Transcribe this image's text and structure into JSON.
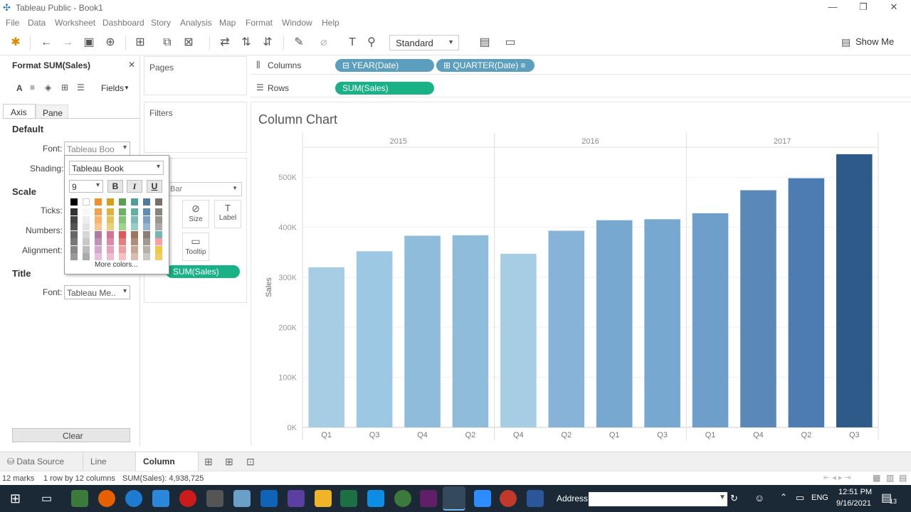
{
  "window": {
    "title": "Tableau Public - Book1",
    "min": "—",
    "restore": "❐",
    "close": "✕"
  },
  "menu": [
    "File",
    "Data",
    "Worksheet",
    "Dashboard",
    "Story",
    "Analysis",
    "Map",
    "Format",
    "Window",
    "Help"
  ],
  "toolbar": {
    "view_size": "Standard",
    "show_me": "Show Me"
  },
  "format_panel": {
    "title": "Format SUM(Sales)",
    "fields_label": "Fields",
    "tabs": [
      "Axis",
      "Pane"
    ],
    "default_head": "Default",
    "font_label": "Font:",
    "font_value": "Tableau Boo",
    "shading_label": "Shading:",
    "scale_head": "Scale",
    "ticks_label": "Ticks:",
    "numbers_label": "Numbers:",
    "alignment_label": "Alignment:",
    "title_head": "Title",
    "title_font_label": "Font:",
    "title_font_value": "Tableau Me..",
    "clear_label": "Clear"
  },
  "font_popup": {
    "font_name": "Tableau Book",
    "font_size": "9",
    "bold": "B",
    "italic": "I",
    "underline": "U",
    "more_colors": "More colors...",
    "top_colors": [
      "#000000",
      "#ffffff",
      "#f28e2b",
      "#d4a017",
      "#59a14f",
      "#4e9e99",
      "#4e79a7",
      "#79706e"
    ],
    "colors": [
      [
        "#333333",
        "#f7f7f7",
        "#f4a04b",
        "#dcb43a",
        "#6cb35f",
        "#63ada7",
        "#5f8bb8",
        "#8a827f"
      ],
      [
        "#444444",
        "#eeeeee",
        "#f7b36b",
        "#e2c25c",
        "#84c277",
        "#7dbcb6",
        "#7b9fc8",
        "#9c9491"
      ],
      [
        "#555555",
        "#e3e3e3",
        "#f9c58c",
        "#e9d07e",
        "#9fd18f",
        "#98ccc6",
        "#97b4d6",
        "#afa7a4"
      ],
      [
        "#666666",
        "#d6d6d6",
        "#b07aa1",
        "#d37295",
        "#e15759",
        "#9d7660",
        "#8a7f78",
        "#76b7b2"
      ],
      [
        "#777777",
        "#c8c8c8",
        "#c390b7",
        "#dd8aa8",
        "#ea7b7c",
        "#b18d79",
        "#a09891",
        "#ff9da7"
      ],
      [
        "#888888",
        "#bbbbbb",
        "#d6a7cd",
        "#e6a2bb",
        "#f29e9f",
        "#c5a593",
        "#b6b0aa",
        "#edc948"
      ],
      [
        "#999999",
        "#aaaaaa",
        "#e6bfdf",
        "#eebbcf",
        "#f8c0c0",
        "#d8bdae",
        "#cbc7c3",
        "#f1ce63"
      ]
    ]
  },
  "cards": {
    "pages": "Pages",
    "filters": "Filters",
    "marks_type": "Bar",
    "size": "Size",
    "label": "Label",
    "tooltip": "Tooltip",
    "marks_pill": "SUM(Sales)"
  },
  "shelves": {
    "columns_label": "Columns",
    "rows_label": "Rows",
    "col_pill1": "YEAR(Date)",
    "col_pill2": "QUARTER(Date)",
    "row_pill": "SUM(Sales)"
  },
  "sheet_title": "Column Chart",
  "chart_data": {
    "type": "bar",
    "ylabel": "Sales",
    "ylim": [
      0,
      560000
    ],
    "yticks": [
      0,
      100000,
      200000,
      300000,
      400000,
      500000
    ],
    "ytick_labels": [
      "0K",
      "100K",
      "200K",
      "300K",
      "400K",
      "500K"
    ],
    "years": [
      "2015",
      "2016",
      "2017"
    ],
    "categories": [
      "Q1",
      "Q3",
      "Q4",
      "Q2",
      "Q4",
      "Q2",
      "Q1",
      "Q3",
      "Q1",
      "Q4",
      "Q2",
      "Q3"
    ],
    "values": [
      320000,
      352000,
      383000,
      384000,
      347000,
      393000,
      414000,
      416000,
      428000,
      474000,
      498000,
      546000
    ],
    "colors": [
      "#a6cde4",
      "#9dc8e3",
      "#8fbcdb",
      "#8fbcdb",
      "#a6cde4",
      "#86b3d7",
      "#77a8cf",
      "#77a8cf",
      "#6e9fca",
      "#5a88b9",
      "#4c7cb1",
      "#2e5a8a"
    ],
    "grid": true,
    "legend": "none"
  },
  "tabs": {
    "data_source": "Data Source",
    "line_chart": "Line Chart",
    "column_chart": "Column Chart"
  },
  "status": {
    "marks": "12 marks",
    "rows_cols": "1 row by 12 columns",
    "sum": "SUM(Sales): 4,938,725"
  },
  "taskbar": {
    "address": "Address",
    "lang": "ENG",
    "time": "12:51 PM",
    "date": "9/16/2021",
    "notif": "13"
  }
}
